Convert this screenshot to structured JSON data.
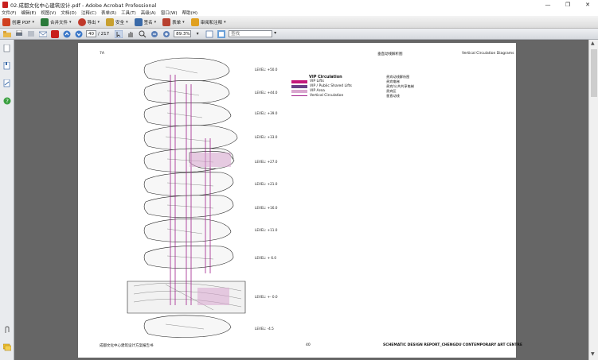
{
  "window": {
    "title": "02.成都文化中心建筑设计.pdf - Adobe Acrobat Professional",
    "controls": [
      "—",
      "❐",
      "✕"
    ]
  },
  "menu": [
    "文件(F)",
    "编辑(E)",
    "视图(V)",
    "文档(D)",
    "注释(C)",
    "表单(R)",
    "工具(T)",
    "高级(A)",
    "窗口(W)",
    "帮助(H)"
  ],
  "tasks": [
    {
      "label": "创建 PDF",
      "color": "#d04020"
    },
    {
      "label": "合并文件",
      "color": "#2a7a3a"
    },
    {
      "label": "导出",
      "color": "#c0392b"
    },
    {
      "label": "安全",
      "color": "#c8a030"
    },
    {
      "label": "签名",
      "color": "#3a6aa8"
    },
    {
      "label": "表单",
      "color": "#b8402f"
    },
    {
      "label": "审阅和注释",
      "color": "#e0a020"
    }
  ],
  "nav": {
    "page_current": "40",
    "page_total": "/ 217",
    "zoom": "89.3%",
    "find_placeholder": "查找"
  },
  "page": {
    "page_id": "7A",
    "header_cn": "垂直动线解析图",
    "header_en": "Vertical Circulation Diagrams",
    "levels": [
      "LEVEL: +50.0",
      "LEVEL: +44.0",
      "LEVEL: +39.0",
      "LEVEL: +33.0",
      "LEVEL: +27.0",
      "LEVEL: +21.0",
      "LEVEL: +16.0",
      "LEVEL: +11.0",
      "LEVEL: + 6.0",
      "LEVEL: +- 0.0",
      "LEVEL: -4.5"
    ],
    "legend": {
      "title": "VIP Circulation",
      "title_cn": "贵宾动线解析图",
      "items": [
        {
          "label": "VIP Lifts",
          "cn": "贵宾电梯",
          "color": "#c4177a"
        },
        {
          "label": "VIP / Public Shared Lifts",
          "cn": "贵宾/公共共享电梯",
          "color": "#6a3f86"
        },
        {
          "label": "VIP Area",
          "cn": "贵宾区",
          "color": "#d9a6cf"
        },
        {
          "label": "Vertical Circulation",
          "cn": "垂直动线",
          "color": "#a0208c"
        }
      ]
    },
    "footer_left": "成都文化中心建筑设计方案报告书",
    "footer_center": "40",
    "footer_right": "SCHEMATIC DESIGN REPORT_CHENGDU CONTEMPORARY ART CENTRE"
  }
}
